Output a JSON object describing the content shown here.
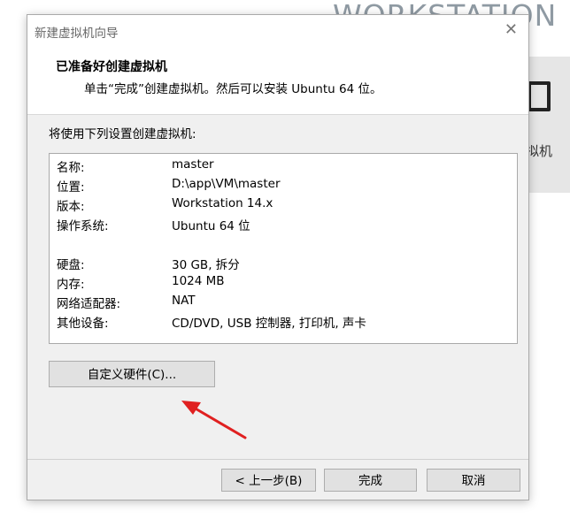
{
  "background": {
    "brand_text": "WORKSTATION",
    "tile_label": "拟机"
  },
  "dialog": {
    "window_title": "新建虚拟机向导",
    "header_title": "已准备好创建虚拟机",
    "header_subtitle": "单击“完成”创建虚拟机。然后可以安装 Ubuntu 64 位。",
    "section_label": "将使用下列设置创建虚拟机:",
    "summary": [
      {
        "key": "名称:",
        "value": "master"
      },
      {
        "key": "位置:",
        "value": "D:\\app\\VM\\master"
      },
      {
        "key": "版本:",
        "value": "Workstation 14.x"
      },
      {
        "key": "操作系统:",
        "value": "Ubuntu 64 位"
      },
      {
        "key": "硬盘:",
        "value": "30 GB, 拆分"
      },
      {
        "key": "内存:",
        "value": "1024 MB"
      },
      {
        "key": "网络适配器:",
        "value": "NAT"
      },
      {
        "key": "其他设备:",
        "value": "CD/DVD, USB 控制器, 打印机, 声卡"
      }
    ],
    "customize_button": "自定义硬件(C)...",
    "back_button": "< 上一步(B)",
    "finish_button": "完成",
    "cancel_button": "取消"
  },
  "colors": {
    "annotation_arrow": "#e02020"
  }
}
